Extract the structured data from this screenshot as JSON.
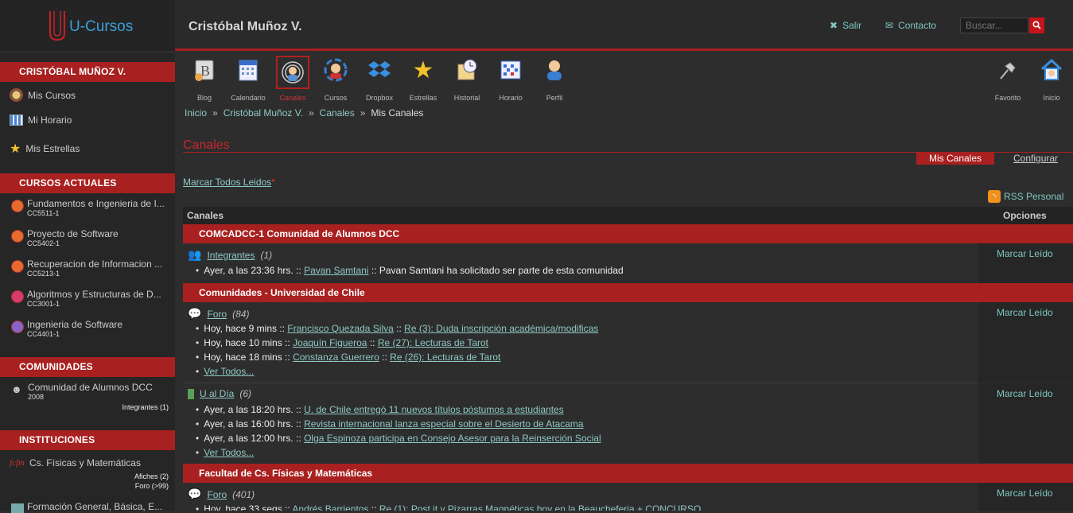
{
  "header": {
    "logo_text": "U-Cursos",
    "user_name": "Cristóbal Muñoz V.",
    "links": [
      {
        "label": "Salir",
        "icon": "x-icon"
      },
      {
        "label": "Contacto",
        "icon": "envelope-icon"
      }
    ],
    "search_placeholder": "Buscar..."
  },
  "sidebar": {
    "user_heading": "CRISTÓBAL MUÑOZ V.",
    "user_items": [
      {
        "label": "Mis Cursos",
        "icon": "courses-icon"
      },
      {
        "label": "Mi Horario",
        "icon": "schedule-icon"
      },
      {
        "label": "Mis Estrellas",
        "icon": "star-icon"
      }
    ],
    "courses_heading": "CURSOS ACTUALES",
    "courses": [
      {
        "name": "Fundamentos e Ingenieria de I...",
        "code": "CC5511-1",
        "color": "#e86b2e"
      },
      {
        "name": "Proyecto de Software",
        "code": "CC5402-1",
        "color": "#e86b2e"
      },
      {
        "name": "Recuperacion de Informacion ...",
        "code": "CC5213-1",
        "color": "#e86b2e"
      },
      {
        "name": "Algoritmos y Estructuras de D...",
        "code": "CC3001-1",
        "color": "#d83a6a"
      },
      {
        "name": "Ingenieria de Software",
        "code": "CC4401-1",
        "color": "#8a63c9"
      }
    ],
    "communities_heading": "COMUNIDADES",
    "community": {
      "name": "Comunidad de Alumnos DCC",
      "year": "2008",
      "extra": "Integrantes (1)"
    },
    "institutions_heading": "INSTITUCIONES",
    "institution": {
      "logo": "fcfm",
      "name": "Cs. Físicas y Matemáticas",
      "afiches": "Afiches (2)",
      "foro": "Foro (>99)"
    },
    "institution2": {
      "name": "Formación General, Básica, E..."
    }
  },
  "toolbar": {
    "items": [
      {
        "label": "Blog",
        "icon": "blog-icon"
      },
      {
        "label": "Calendario",
        "icon": "calendar-icon"
      },
      {
        "label": "Canales",
        "icon": "channels-icon",
        "active": true
      },
      {
        "label": "Cursos",
        "icon": "courses-icon"
      },
      {
        "label": "Dropbox",
        "icon": "dropbox-icon"
      },
      {
        "label": "Estrellas",
        "icon": "stars-icon"
      },
      {
        "label": "Historial",
        "icon": "history-icon"
      },
      {
        "label": "Horario",
        "icon": "schedule-icon"
      },
      {
        "label": "Perfil",
        "icon": "profile-icon"
      }
    ],
    "right_items": [
      {
        "label": "Favorito",
        "icon": "pin-icon"
      },
      {
        "label": "Inicio",
        "icon": "home-icon"
      }
    ]
  },
  "breadcrumb": [
    "Inicio",
    "Cristóbal Muñoz V.",
    "Canales",
    "Mis Canales"
  ],
  "main": {
    "section_title": "Canales",
    "tab_active": "Mis Canales",
    "tab_config": "Configurar",
    "mark_all": "Marcar Todos Leidos",
    "mark_all_star": "*",
    "rss": "RSS Personal",
    "col_channels": "Canales",
    "col_options": "Opciones",
    "mark_read": "Marcar Leído",
    "groups": [
      {
        "title": "COMCADCC-1 Comunidad de Alumnos DCC"
      },
      {
        "title": "Comunidades - Universidad de Chile"
      },
      {
        "title": "Facultad de Cs. Físicas y Matemáticas"
      }
    ],
    "ch1": {
      "name": "Integrantes",
      "count": "(1)",
      "items": [
        {
          "when": "Ayer, a las 23:36 hrs.",
          "who": "Pavan Samtani",
          "text": "Pavan Samtani ha solicitado ser parte de esta comunidad"
        }
      ]
    },
    "ch2": {
      "name": "Foro",
      "count": "(84)",
      "items": [
        {
          "when": "Hoy, hace 9 mins",
          "who": "Francisco Quezada Silva",
          "text": "Re (3): Duda inscripción académica/modificas"
        },
        {
          "when": "Hoy, hace 10 mins",
          "who": "Joaquín Figueroa",
          "text": "Re (27): Lecturas de Tarot"
        },
        {
          "when": "Hoy, hace 18 mins",
          "who": "Constanza Guerrero",
          "text": "Re (26): Lecturas de Tarot"
        }
      ],
      "more": "Ver Todos..."
    },
    "ch3": {
      "name": "U al Día",
      "count": "(6)",
      "items": [
        {
          "when": "Ayer, a las 18:20 hrs.",
          "text": "U. de Chile entregó 11 nuevos títulos póstumos a estudiantes"
        },
        {
          "when": "Ayer, a las 16:00 hrs.",
          "text": "Revista internacional lanza especial sobre el Desierto de Atacama"
        },
        {
          "when": "Ayer, a las 12:00 hrs.",
          "text": "Olga Espinoza participa en Consejo Asesor para la Reinserción Social"
        }
      ],
      "more": "Ver Todos..."
    },
    "ch4": {
      "name": "Foro",
      "count": "(401)",
      "items": [
        {
          "when": "Hoy, hace 33 segs",
          "who": "Andrés Barrientos",
          "text": "Re (1): Post it y Pizarras Magnéticas hoy en la Beaucheferia + CONCURSO"
        }
      ]
    }
  },
  "sep": "::",
  "crumb_sep": "»"
}
